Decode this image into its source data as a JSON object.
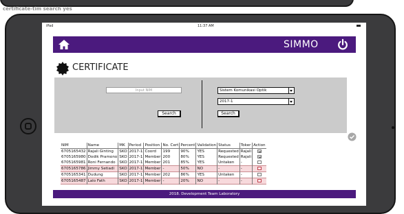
{
  "caption": "certificate-tim search yes",
  "statusbar": {
    "carrier": "iPad",
    "time": "11:37 AM"
  },
  "navbar": {
    "brand": "SIMMO",
    "home_icon": "home-icon",
    "power_icon": "power-icon",
    "color": "#4b1a7e"
  },
  "page": {
    "title": "CERTIFICATE",
    "icon": "certificate-badge-icon"
  },
  "search": {
    "nim_placeholder": "Input NIM",
    "left_button": "Search",
    "course_select": "Sistem Komunikasi Optik",
    "period_select": "2017-1",
    "right_button": "Search"
  },
  "table": {
    "columns": [
      "NIM",
      "Name",
      "MK",
      "Period",
      "Position",
      "No. Cert",
      "Percent",
      "Validation",
      "Status",
      "Toker",
      "Action"
    ],
    "rows": [
      {
        "cells": [
          "6705165432",
          "Rajali Ginting",
          "SKO",
          "2017-1",
          "Coord",
          "199",
          "90%",
          "YES",
          "Requested",
          "Rajali"
        ],
        "action": "checked",
        "alert": false
      },
      {
        "cells": [
          "6705165980",
          "Dodik Pramono",
          "SKO",
          "2017-1",
          "Member",
          "200",
          "80%",
          "YES",
          "Requested",
          "Rajali"
        ],
        "action": "checked",
        "alert": false
      },
      {
        "cells": [
          "6705165981",
          "Roni Fernando",
          "SKO",
          "2017-1",
          "Member",
          "201",
          "85%",
          "YES",
          "Untaken",
          "-"
        ],
        "action": "empty",
        "alert": false
      },
      {
        "cells": [
          "6705165786",
          "Jimmy Setiadi",
          "SKO",
          "2017-1",
          "Member",
          "-",
          "50%",
          "NO",
          "-",
          "-"
        ],
        "action": "red",
        "alert": true
      },
      {
        "cells": [
          "6705165341",
          "Dudung",
          "SKO",
          "2017-1",
          "Member",
          "202",
          "86%",
          "YES",
          "Untaken",
          "-"
        ],
        "action": "empty",
        "alert": false
      },
      {
        "cells": [
          "6705165487",
          "Lalo Fath",
          "SKO",
          "2017-1",
          "Member",
          "-",
          "20%",
          "NO",
          "-",
          "-"
        ],
        "action": "red",
        "alert": true
      }
    ]
  },
  "footer": {
    "text": "2018. Development Team Laboratory"
  }
}
